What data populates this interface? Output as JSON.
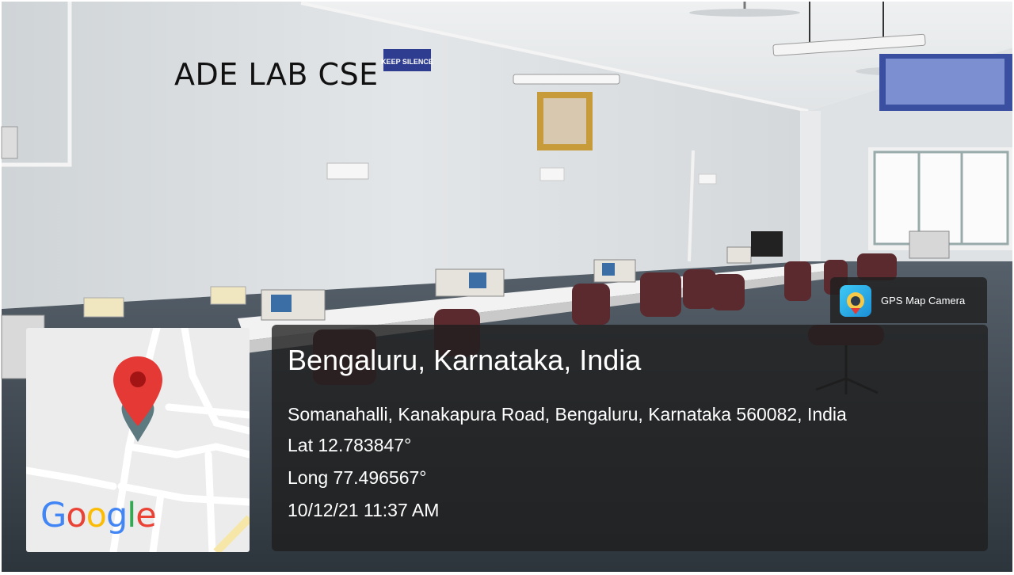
{
  "photo": {
    "caption": "ADE LAB CSE",
    "wall_sign": "KEEP SILENCE"
  },
  "app": {
    "name": "GPS Map Camera",
    "icon": "camera-pin-icon"
  },
  "location": {
    "title": "Bengaluru, Karnataka, India",
    "address": "Somanahalli, Kanakapura Road, Bengaluru, Karnataka 560082, India",
    "lat": "Lat 12.783847°",
    "long": "Long 77.496567°",
    "datetime": "10/12/21 11:37 AM"
  },
  "map": {
    "brand": "Google",
    "marker_color": "#e53935",
    "icon": "map-pin-icon"
  },
  "colors": {
    "overlay": "#1e1e1e",
    "wall": "#d9dde0",
    "floor": "#3c4650"
  }
}
